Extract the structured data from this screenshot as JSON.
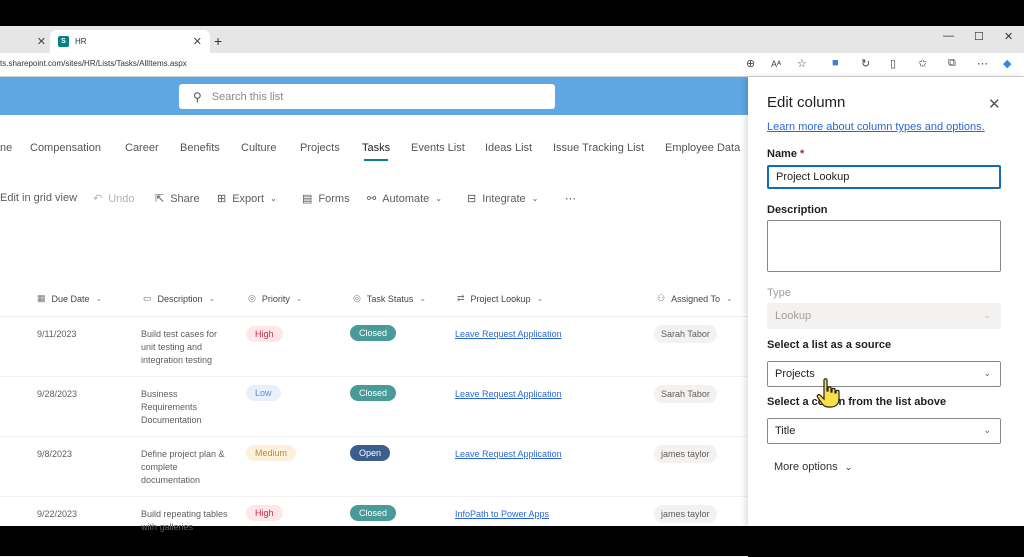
{
  "browser": {
    "tab_title": "HR",
    "url": "ts.sharepoint.com/sites/HR/Lists/Tasks/AllItems.aspx"
  },
  "search": {
    "placeholder": "Search this list"
  },
  "nav": [
    "ne",
    "Compensation",
    "Career",
    "Benefits",
    "Culture",
    "Projects",
    "Tasks",
    "Events List",
    "Ideas List",
    "Issue Tracking List",
    "Employee Data"
  ],
  "commands": {
    "grid": "Edit in grid view",
    "undo": "Undo",
    "share": "Share",
    "export": "Export",
    "forms": "Forms",
    "automate": "Automate",
    "integrate": "Integrate"
  },
  "columns": {
    "due": "Due Date",
    "desc": "Description",
    "priority": "Priority",
    "status": "Task Status",
    "lookup": "Project Lookup",
    "assigned": "Assigned To"
  },
  "rows": [
    {
      "due": "9/11/2023",
      "desc": "Build test cases for unit testing and integration testing",
      "priority": "High",
      "status": "Closed",
      "lookup": "Leave Request Application",
      "assigned": "Sarah Tabor"
    },
    {
      "due": "9/28/2023",
      "desc": "Business Requirements Documentation",
      "priority": "Low",
      "status": "Closed",
      "lookup": "Leave Request Application",
      "assigned": "Sarah Tabor"
    },
    {
      "due": "9/8/2023",
      "desc": "Define project plan & complete documentation",
      "priority": "Medium",
      "status": "Open",
      "lookup": "Leave Request Application",
      "assigned": "james taylor"
    },
    {
      "due": "9/22/2023",
      "desc": "Build repeating tables with galleries",
      "priority": "High",
      "status": "Closed",
      "lookup": "InfoPath to Power Apps",
      "assigned": "james taylor"
    }
  ],
  "colors": {
    "high_bg": "#fde7e9",
    "high_fg": "#c4314b",
    "low_bg": "#e8f1fb",
    "low_fg": "#5a8fd0",
    "medium_bg": "#fdf1dc",
    "medium_fg": "#b38a3a",
    "closed_bg": "#4a9a9a",
    "open_bg": "#3b5e8c",
    "banner": "#5ea6e4",
    "accent": "#0f6cbd"
  },
  "panel": {
    "title": "Edit column",
    "learn_link": "Learn more about column types and options.",
    "name_label": "Name",
    "required_mark": "*",
    "name_value": "Project Lookup",
    "description_label": "Description",
    "type_label": "Type",
    "type_value": "Lookup",
    "source_label": "Select a list as a source",
    "source_value": "Projects",
    "column_label_a": "Select a co",
    "column_label_b": "n from the list above",
    "column_value": "Title",
    "more_options": "More options"
  }
}
